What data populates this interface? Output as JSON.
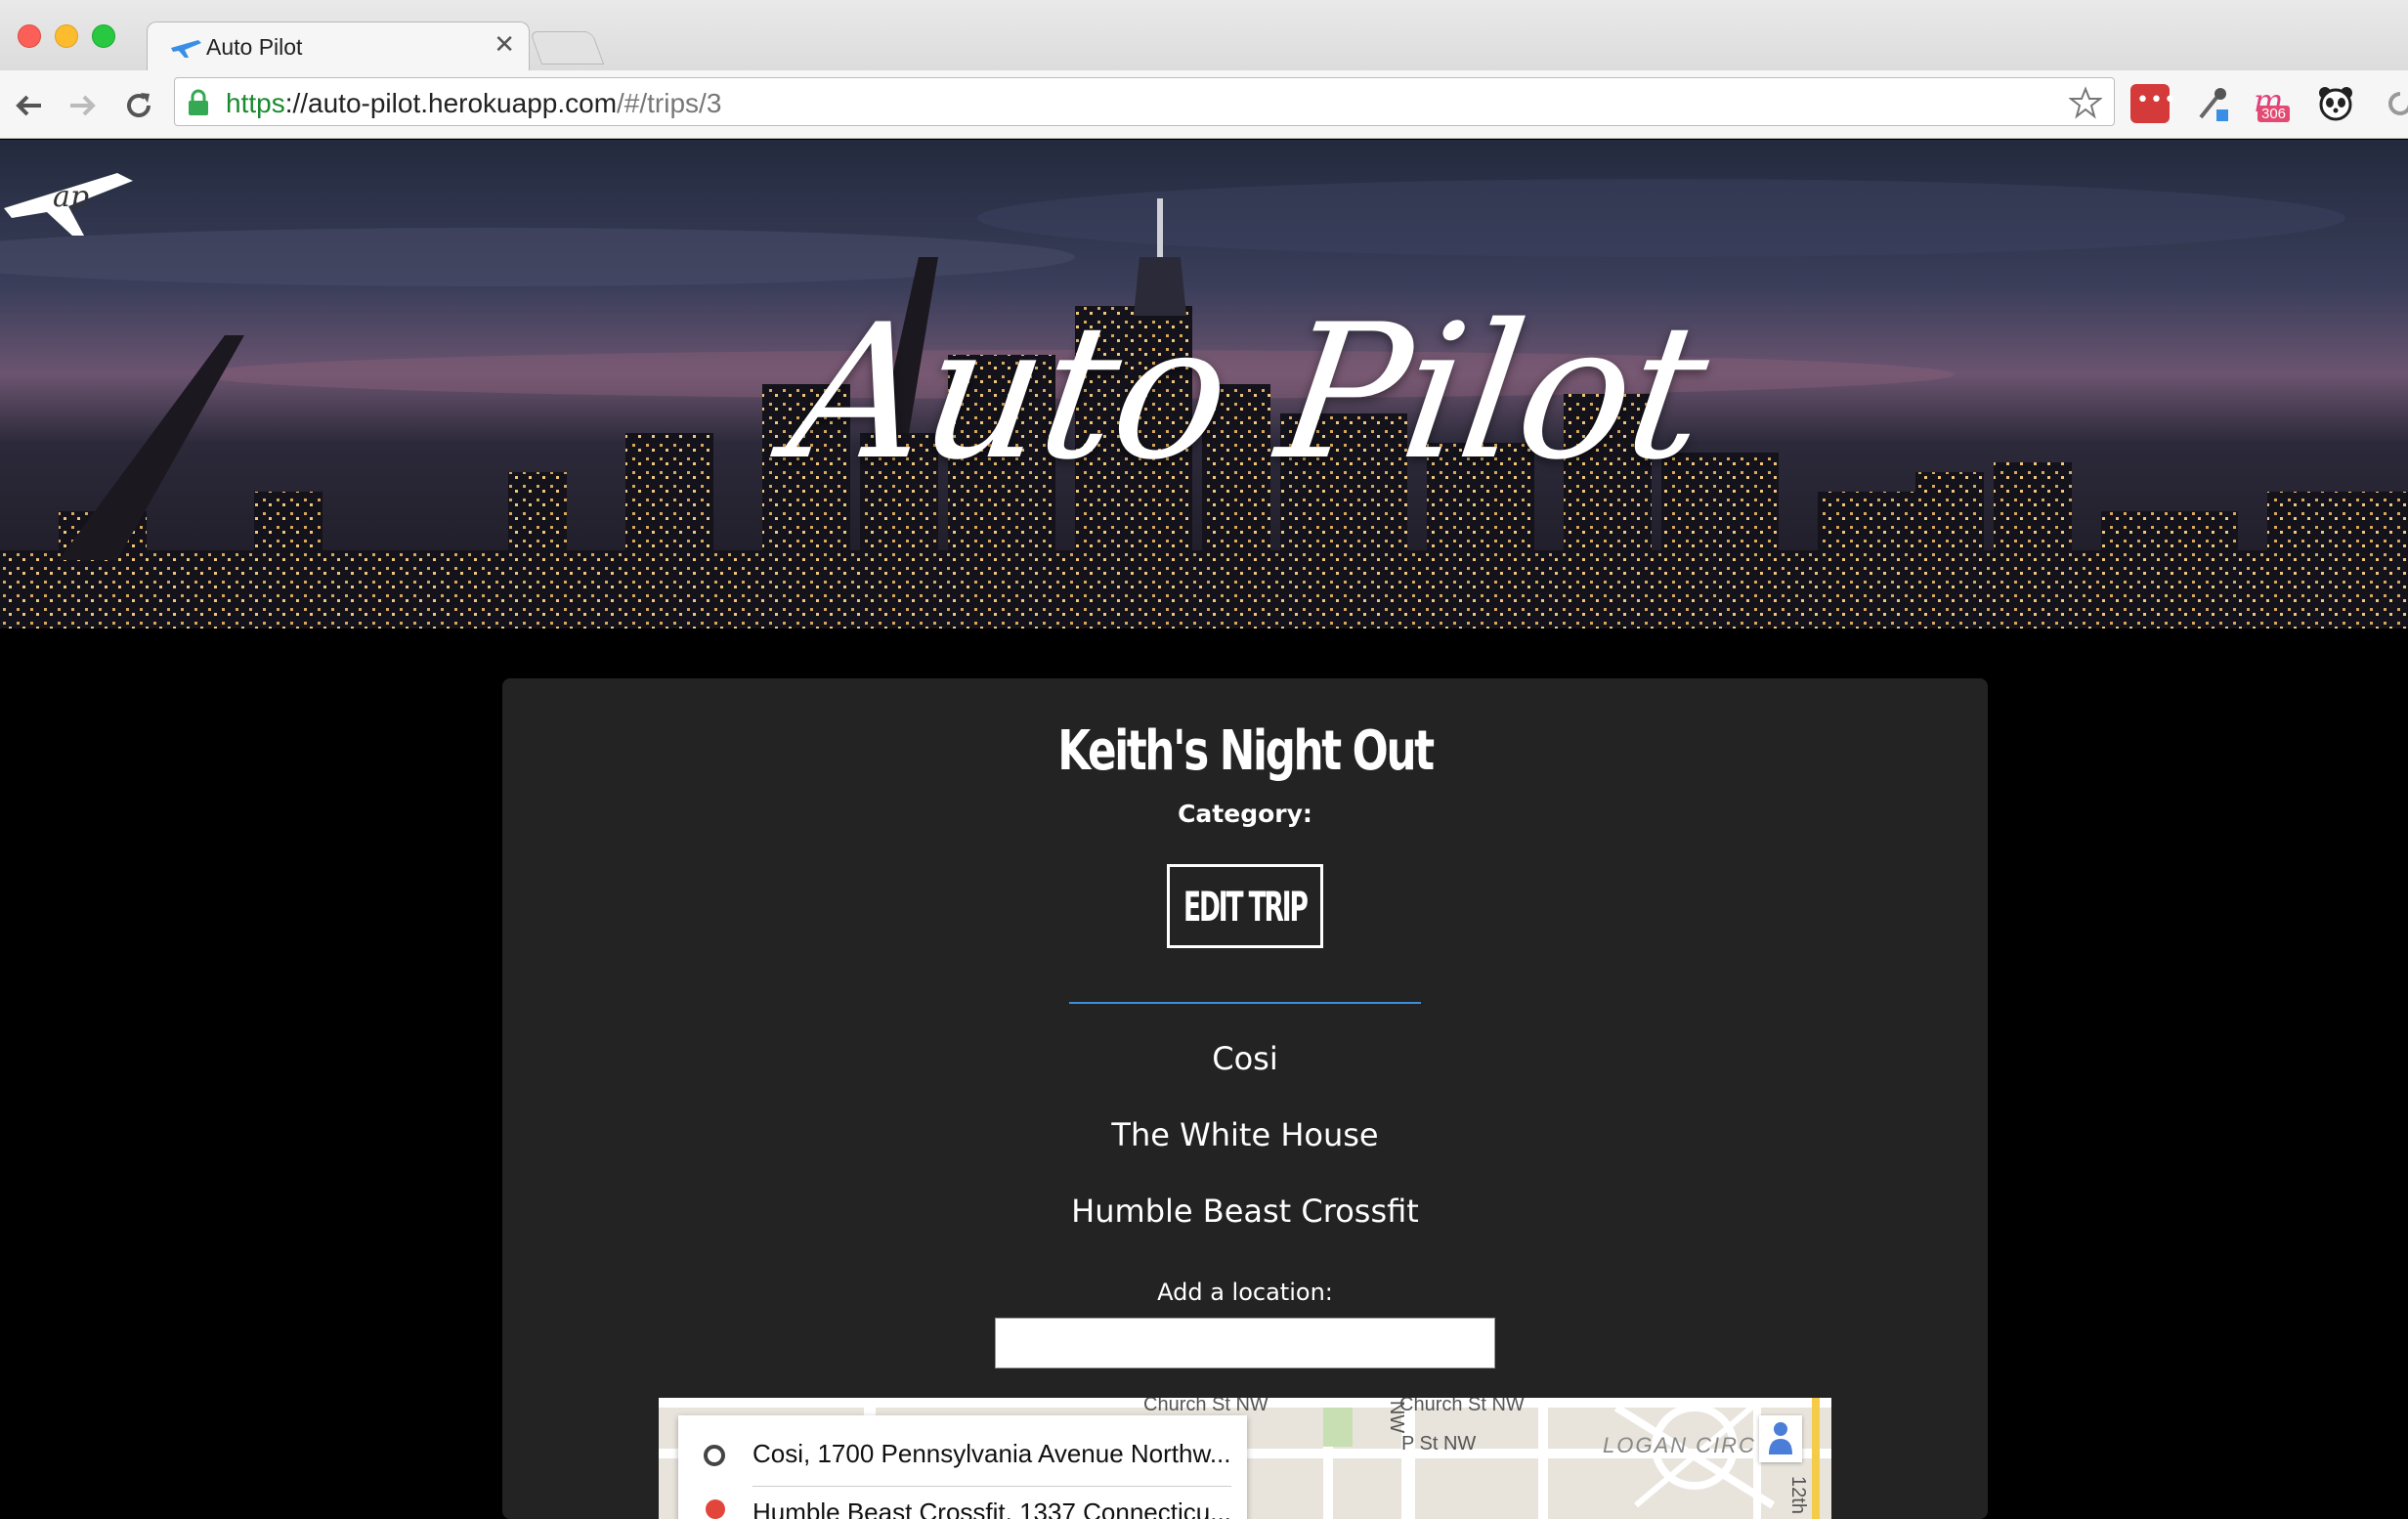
{
  "browser": {
    "tab_title": "Auto Pilot",
    "tab_close": "✕",
    "url_scheme": "https",
    "url_host": "://auto-pilot.herokuapp.com",
    "url_path": "/#/trips/3",
    "lastpass_label": "•••",
    "ext_m_letter": "m",
    "ext_m_badge": "306"
  },
  "hero": {
    "title": "Auto Pilot",
    "logo_text": "ap"
  },
  "trip": {
    "name": "Keith's Night Out",
    "category_label": "Category:",
    "edit_button": "EDIT TRIP",
    "locations": [
      "Cosi",
      "The White House",
      "Humble Beast Crossfit"
    ],
    "add_location_label": "Add a location:",
    "add_location_value": ""
  },
  "map": {
    "labels": {
      "church_st_1": "Church St NW",
      "church_st_2": "Church St NW",
      "nw": "NW",
      "p_st": "P St NW",
      "logan": "LOGAN CIRC",
      "twelfth": "12th"
    },
    "origin": "Cosi, 1700 Pennsylvania Avenue Northw...",
    "destination": "Humble Beast Crossfit, 1337 Connecticu..."
  },
  "colors": {
    "card_bg": "#232323",
    "divider": "#3b8fd9",
    "page_bg": "#000000"
  }
}
